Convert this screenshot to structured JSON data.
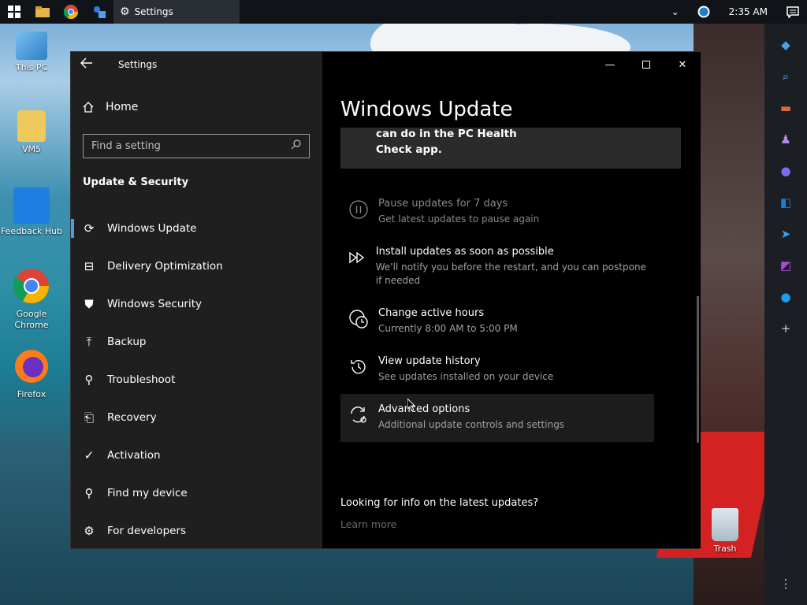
{
  "taskbar": {
    "active_window_label": "Settings",
    "clock": "2:35 AM"
  },
  "desktop_icons": [
    {
      "label": "This PC",
      "icon": "monitor-icon"
    },
    {
      "label": "VM5",
      "icon": "user-folder-icon"
    },
    {
      "label": "Feedback Hub",
      "icon": "feedback-hub-icon"
    },
    {
      "label": "Google Chrome",
      "icon": "chrome-icon"
    },
    {
      "label": "Firefox",
      "icon": "firefox-icon"
    },
    {
      "label": "Trash",
      "icon": "recycle-bin-icon"
    }
  ],
  "window": {
    "title": "Settings",
    "home_label": "Home",
    "search_placeholder": "Find a setting",
    "section_title": "Update & Security",
    "nav_items": [
      {
        "label": "Windows Update",
        "icon": "refresh-icon",
        "selected": true
      },
      {
        "label": "Delivery Optimization",
        "icon": "delivery-icon"
      },
      {
        "label": "Windows Security",
        "icon": "shield-icon"
      },
      {
        "label": "Backup",
        "icon": "backup-arrow-icon"
      },
      {
        "label": "Troubleshoot",
        "icon": "wrench-icon"
      },
      {
        "label": "Recovery",
        "icon": "recovery-icon"
      },
      {
        "label": "Activation",
        "icon": "check-circle-icon"
      },
      {
        "label": "Find my device",
        "icon": "person-pin-icon"
      },
      {
        "label": "For developers",
        "icon": "developer-icon"
      }
    ]
  },
  "main": {
    "page_title": "Windows Update",
    "card_line1": "can do in the PC Health",
    "card_line2": "Check app.",
    "options": [
      {
        "title": "Pause updates for 7 days",
        "sub": "Get latest updates to pause again",
        "icon": "pause-icon",
        "disabled": true
      },
      {
        "title": "Install updates as soon as possible",
        "sub": "We'll notify you before the restart, and you can postpone if needed",
        "icon": "fast-forward-icon"
      },
      {
        "title": "Change active hours",
        "sub": "Currently 8:00 AM to 5:00 PM",
        "icon": "clock-icon"
      },
      {
        "title": "View update history",
        "sub": "See updates installed on your device",
        "icon": "history-icon"
      },
      {
        "title": "Advanced options",
        "sub": "Additional update controls and settings",
        "icon": "advanced-sync-icon"
      }
    ],
    "info_title": "Looking for info on the latest updates?",
    "learn_more": "Learn more"
  },
  "colors": {
    "accent": "#4aa0e6",
    "window_bg": "#000000",
    "nav_bg": "#1f1f1f"
  }
}
